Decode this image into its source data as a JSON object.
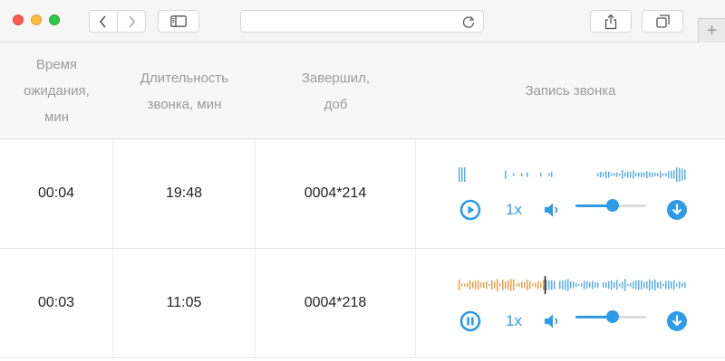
{
  "browser": {
    "address_value": "",
    "new_tab_label": "+"
  },
  "table": {
    "headers": [
      "Время\nожидания,\nмин",
      "Длительность\nзвонка, мин",
      "Завершил,\nдоб",
      "Запись звонка"
    ],
    "rows": [
      {
        "wait": "00:04",
        "duration": "19:48",
        "ended_by": "0004*214",
        "player": {
          "state": "paused",
          "speed": "1x",
          "volume": 0.52,
          "progress": 0.0
        }
      },
      {
        "wait": "00:03",
        "duration": "11:05",
        "ended_by": "0004*218",
        "player": {
          "state": "playing",
          "speed": "1x",
          "volume": 0.52,
          "progress": 0.38
        }
      }
    ]
  },
  "colors": {
    "accent": "#2d9ce8",
    "played": "#e8a04a",
    "unplayed": "#5aaee9"
  },
  "icons": {
    "back": "chevron-left-icon",
    "forward": "chevron-right-icon",
    "sidebar": "sidebar-icon",
    "reload": "reload-icon",
    "share": "share-icon",
    "tabs": "tabs-icon",
    "play": "play-icon",
    "pause": "pause-icon",
    "volume": "volume-icon",
    "download": "download-icon"
  }
}
